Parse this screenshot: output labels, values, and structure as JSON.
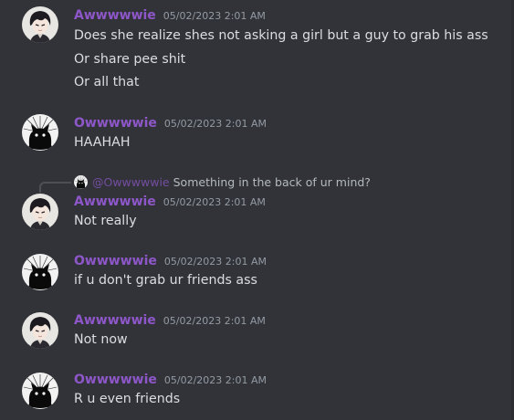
{
  "users": {
    "a": {
      "name": "Awwwwwie",
      "avatar_icon": "dark-haired-anime-boy-avatar-icon"
    },
    "b": {
      "name": "Owwwwwie",
      "avatar_icon": "black-cat-silhouette-avatar-icon"
    }
  },
  "colors": {
    "background": "#313338",
    "username": "#8e57c9",
    "timestamp": "#949ba4",
    "text": "#dbdee1"
  },
  "messages": [
    {
      "author": "Awwwwwie",
      "timestamp": "05/02/2023 2:01 AM",
      "lines": [
        "Does she realize shes not asking a girl but a guy to grab his ass",
        "Or share pee shit",
        "Or all that"
      ]
    },
    {
      "author": "Owwwwwie",
      "timestamp": "05/02/2023 2:01 AM",
      "lines": [
        "HAAHAH"
      ]
    },
    {
      "author": "Awwwwwie",
      "timestamp": "05/02/2023 2:01 AM",
      "reply": {
        "user": "@Owwwwwie",
        "text": "Something in the back of ur mind?"
      },
      "lines": [
        "Not really"
      ]
    },
    {
      "author": "Owwwwwie",
      "timestamp": "05/02/2023 2:01 AM",
      "lines": [
        "if u don't grab ur friends ass"
      ]
    },
    {
      "author": "Awwwwwie",
      "timestamp": "05/02/2023 2:01 AM",
      "lines": [
        "Not now"
      ]
    },
    {
      "author": "Owwwwwie",
      "timestamp": "05/02/2023 2:01 AM",
      "lines": [
        "R u even friends"
      ]
    }
  ]
}
